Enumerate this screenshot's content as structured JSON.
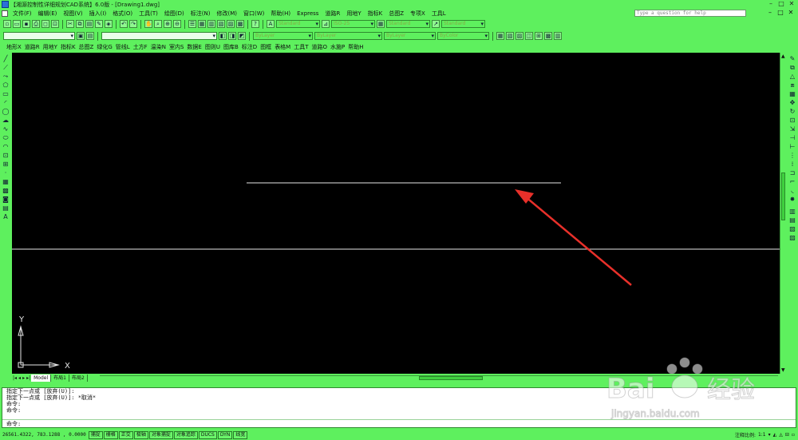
{
  "window": {
    "title": "【湘源控制性详细规划CAD系统】6.0版 - [Drawing1.dwg]",
    "min": "–",
    "max": "□",
    "close": "✕"
  },
  "menubar": {
    "items": [
      "文件(F)",
      "编辑(E)",
      "视图(V)",
      "插入(I)",
      "格式(O)",
      "工具(T)",
      "绘图(D)",
      "标注(N)",
      "修改(M)",
      "窗口(W)",
      "帮助(H)",
      "Express",
      "道路R",
      "用地Y",
      "指标K",
      "总图Z",
      "专项X",
      "工具L"
    ],
    "help_placeholder": "Type a question for help"
  },
  "toolbar2": {
    "text_style": "Standard",
    "dim_style": "ISO-25",
    "table_style": "Standard",
    "ml_style": "Standard"
  },
  "toolbar3": {
    "layer": "ByLayer",
    "linetype": "ByLayer",
    "lineweight": "ByLayer",
    "color": "ByColor"
  },
  "cnmenu": {
    "items": [
      "地形X",
      "道路R",
      "用地Y",
      "指标K",
      "总图Z",
      "绿化G",
      "管线L",
      "土方F",
      "温染N",
      "室内S",
      "数据E",
      "图则U",
      "图库B",
      "标注D",
      "图框",
      "表格M",
      "工具T",
      "道路O",
      "水施P",
      "帮助H"
    ]
  },
  "canvas": {
    "ucs_x": "X",
    "ucs_y": "Y"
  },
  "tabs": {
    "nav": [
      "|◂",
      "◂",
      "▸",
      "▸|"
    ],
    "items": [
      "Model",
      "布局1",
      "布局2"
    ]
  },
  "command": {
    "lines": [
      "指定下一点或 [放弃(U)]:",
      "指定下一点或 [放弃(U)]: *取消*",
      "命令:",
      "命令:"
    ],
    "prompt": "命令:"
  },
  "statusbar": {
    "coords": "26561.4322, 783.1288 , 0.0000",
    "buttons": [
      "捕捉",
      "栅格",
      "正交",
      "极轴",
      "对象捕捉",
      "对象追踪",
      "DUCS",
      "DYN",
      "线宽"
    ],
    "scale_label": "注释比例:",
    "scale_value": "1:1"
  },
  "colors": {
    "theme": "#5ef05e",
    "canvas": "#000000",
    "arrow": "#e8302a"
  }
}
